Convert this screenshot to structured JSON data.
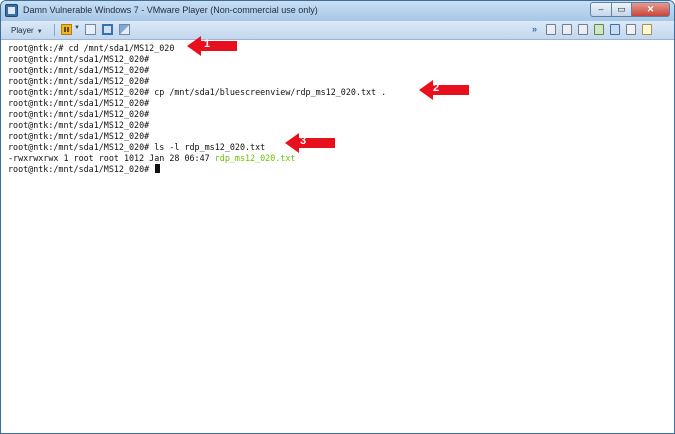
{
  "window": {
    "title": "Damn Vulnerable Windows 7 - VMware Player (Non-commercial use only)",
    "buttons": {
      "minimize": "–",
      "maximize": "▭",
      "close": "✕"
    }
  },
  "toolbar": {
    "player_label": "Player",
    "icons": [
      "pause-icon",
      "send-ctrl-alt-del-icon",
      "fullscreen-icon",
      "unity-icon"
    ],
    "device_icons": [
      "forward-icon",
      "hard-disk-icon",
      "cd-drive-icon",
      "floppy-icon",
      "usb-icon",
      "network-icon",
      "sound-icon",
      "message-icon"
    ]
  },
  "terminal": {
    "lines": [
      {
        "text": "root@ntk:/# cd /mnt/sda1/MS12_020",
        "extra": ""
      },
      {
        "text": "root@ntk:/mnt/sda1/MS12_020#",
        "extra": ""
      },
      {
        "text": "root@ntk:/mnt/sda1/MS12_020#",
        "extra": ""
      },
      {
        "text": "root@ntk:/mnt/sda1/MS12_020#",
        "extra": ""
      },
      {
        "text": "root@ntk:/mnt/sda1/MS12_020# cp /mnt/sda1/bluescreenview/rdp_ms12_020.txt .",
        "extra": ""
      },
      {
        "text": "root@ntk:/mnt/sda1/MS12_020#",
        "extra": ""
      },
      {
        "text": "root@ntk:/mnt/sda1/MS12_020#",
        "extra": ""
      },
      {
        "text": "root@ntk:/mnt/sda1/MS12_020#",
        "extra": ""
      },
      {
        "text": "root@ntk:/mnt/sda1/MS12_020#",
        "extra": ""
      },
      {
        "text": "root@ntk:/mnt/sda1/MS12_020# ls -l rdp_ms12_020.txt",
        "extra": ""
      },
      {
        "text": "-rwxrwxrwx 1 root root 1012 Jan 28 06:47 ",
        "extra": "rdp_ms12_020.txt"
      },
      {
        "text": "root@ntk:/mnt/sda1/MS12_020# ",
        "extra": ""
      }
    ]
  },
  "annotations": [
    {
      "label": "1",
      "color": "#e8101c"
    },
    {
      "label": "2",
      "color": "#e8101c"
    },
    {
      "label": "3",
      "color": "#e8101c"
    }
  ]
}
